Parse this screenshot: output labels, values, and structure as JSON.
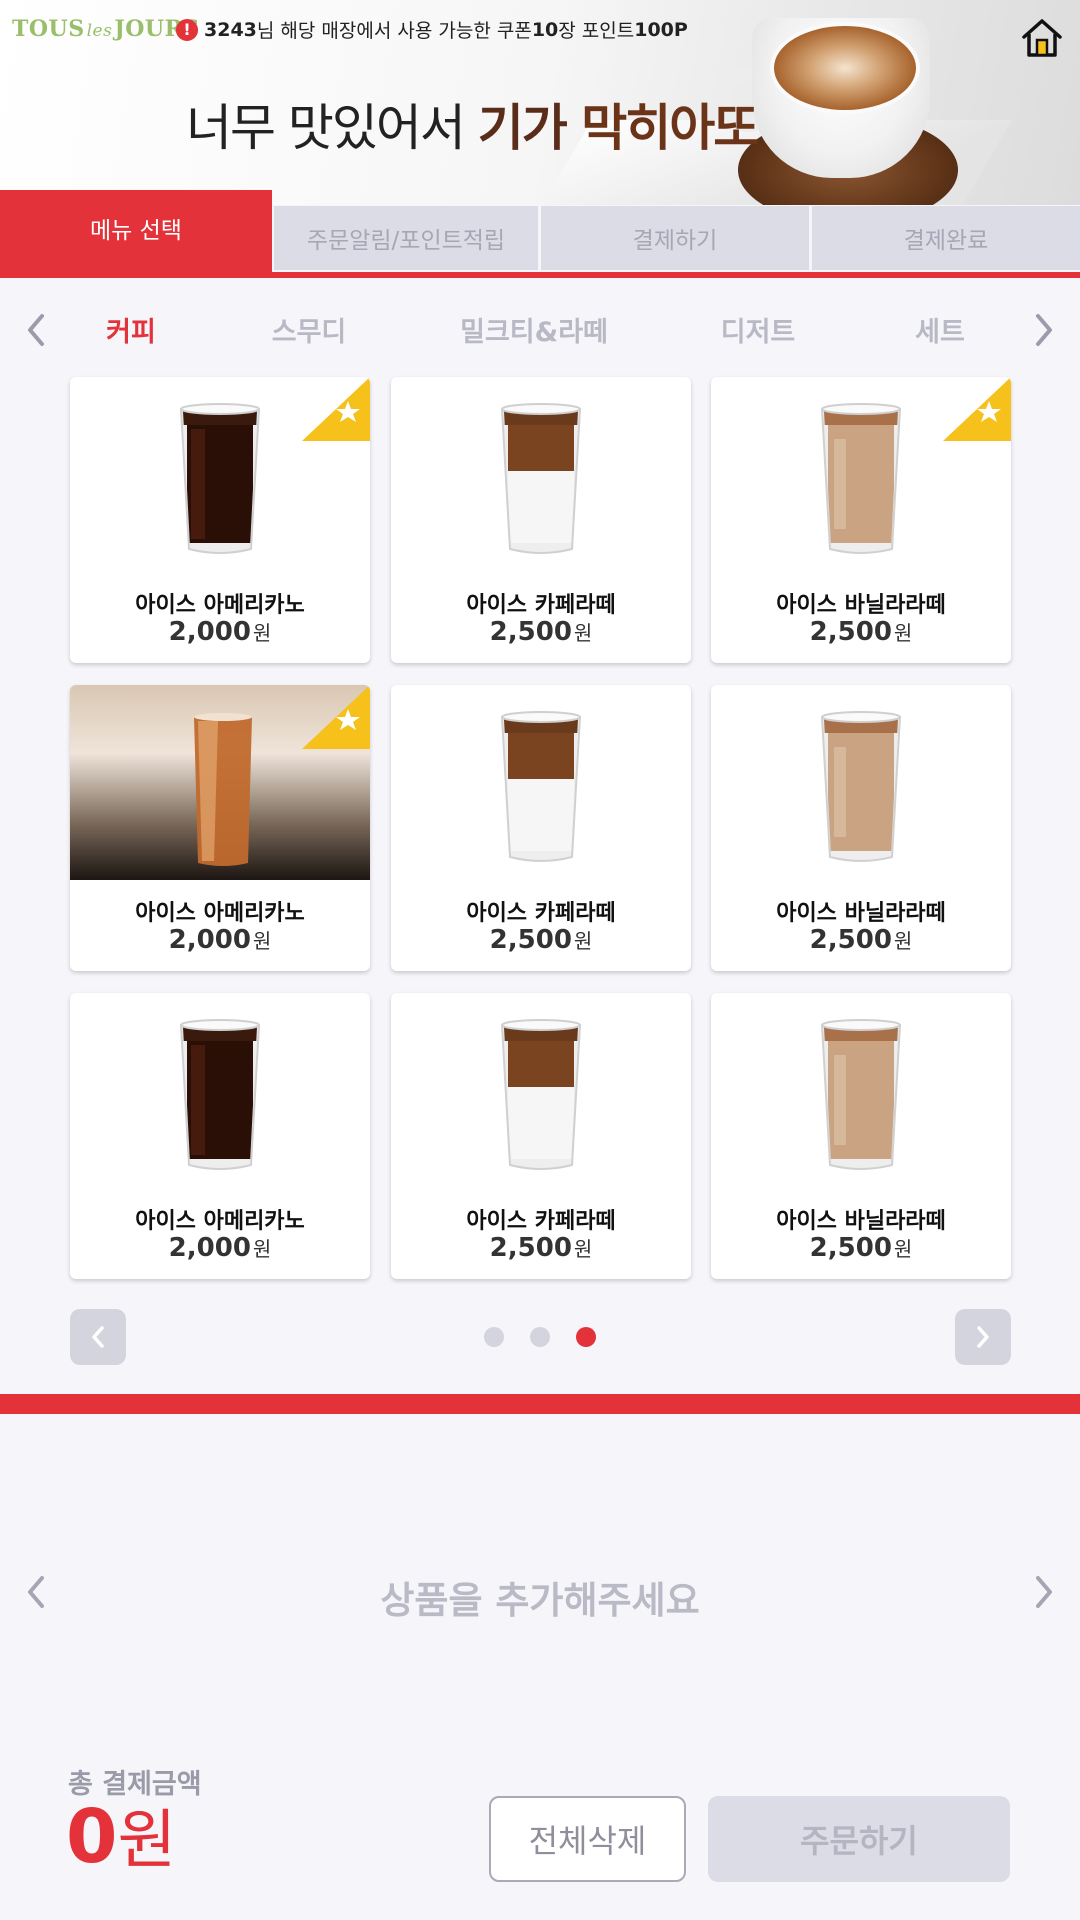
{
  "header": {
    "logo": {
      "brand1": "TOUS",
      "brand_mid": "les",
      "brand2": "JOURS"
    },
    "notice": {
      "user_id": "3243",
      "text_part1": "님 해당 매장에서 사용 가능한 쿠폰 ",
      "coupon_count": "10",
      "text_part2": "장 포인트 ",
      "points": "100P"
    },
    "slogan": {
      "part1": "너무 맛있어서 ",
      "part2": "기가 ",
      "part3": "막히아또"
    },
    "home_icon": "home-icon"
  },
  "steps": [
    {
      "label": "메뉴 선택",
      "active": true
    },
    {
      "label": "주문알림/포인트적립",
      "active": false
    },
    {
      "label": "결제하기",
      "active": false
    },
    {
      "label": "결제완료",
      "active": false
    }
  ],
  "categories": [
    {
      "label": "커피",
      "active": true
    },
    {
      "label": "스무디",
      "active": false
    },
    {
      "label": "밀크티&라떼",
      "active": false
    },
    {
      "label": "디저트",
      "active": false
    },
    {
      "label": "세트",
      "active": false
    }
  ],
  "products": [
    {
      "name": "아이스 아메리카노",
      "price": "2,000",
      "unit": "원",
      "type": "americano",
      "favorite": true
    },
    {
      "name": "아이스 카페라떼",
      "price": "2,500",
      "unit": "원",
      "type": "latte",
      "favorite": false
    },
    {
      "name": "아이스 바닐라라떼",
      "price": "2,500",
      "unit": "원",
      "type": "vanilla",
      "favorite": true
    },
    {
      "name": "아이스 아메리카노",
      "price": "2,000",
      "unit": "원",
      "type": "photo",
      "favorite": true
    },
    {
      "name": "아이스 카페라떼",
      "price": "2,500",
      "unit": "원",
      "type": "latte",
      "favorite": false
    },
    {
      "name": "아이스 바닐라라떼",
      "price": "2,500",
      "unit": "원",
      "type": "vanilla",
      "favorite": false
    },
    {
      "name": "아이스 아메리카노",
      "price": "2,000",
      "unit": "원",
      "type": "americano",
      "favorite": false
    },
    {
      "name": "아이스 카페라떼",
      "price": "2,500",
      "unit": "원",
      "type": "latte",
      "favorite": false
    },
    {
      "name": "아이스 바닐라라떼",
      "price": "2,500",
      "unit": "원",
      "type": "vanilla",
      "favorite": false
    }
  ],
  "pager": {
    "total_pages": 3,
    "current_page": 3
  },
  "cart": {
    "empty_message": "상품을 추가해주세요",
    "total_label": "총 결제금액",
    "total_amount": "0",
    "total_unit": "원",
    "clear_label": "전체삭제",
    "order_label": "주문하기"
  },
  "colors": {
    "accent": "#e4323a",
    "inactive_tab": "#dcdce6",
    "background": "#f5f5fa",
    "favorite_badge": "#f5c11a"
  }
}
